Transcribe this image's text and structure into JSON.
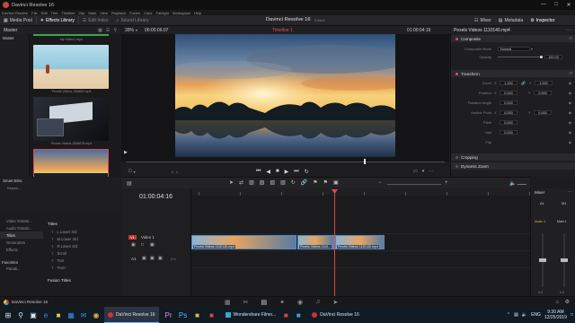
{
  "window": {
    "title": "Davinci Resolve 16",
    "min_icon": "minimize-icon",
    "max_icon": "maximize-icon",
    "close_icon": "close-icon"
  },
  "menu": [
    "DaVinci Resolve",
    "File",
    "Edit",
    "Trim",
    "Timeline",
    "Clip",
    "Mark",
    "View",
    "Playback",
    "Fusion",
    "Color",
    "Fairlight",
    "Workspace",
    "Help"
  ],
  "toolbar": {
    "media_pool": "Media Pool",
    "effects_library": "Effects Library",
    "edit_index": "Edit Index",
    "sound_library": "Sound Library",
    "project_name": "Davinci Resolve 16",
    "project_status": "Edited",
    "mixer": "Mixer",
    "metadata": "Metadata",
    "inspector": "Inspector"
  },
  "media_pool": {
    "bin_title": "Master",
    "zoom": "39%",
    "smart_bins": "Smart Bins",
    "keywords": "Keywo...",
    "clips": [
      {
        "caption": "My Video1.mp4"
      },
      {
        "caption": "Pexels Videos 180882.mp4"
      },
      {
        "caption": "Pexels Videos 1536675.mp4"
      },
      {
        "caption": "Timeline 1"
      }
    ]
  },
  "viewer": {
    "zoom": "39%",
    "source_tc": "00:00:06:07",
    "timeline_name": "Timeline 1",
    "timecode": "01:00:04:16"
  },
  "inspector": {
    "clip_title": "Pexels Videos 1110140.mp4",
    "composite": {
      "title": "Composite",
      "mode_label": "Composite Mode",
      "mode_value": "Normal",
      "opacity_label": "Opacity",
      "opacity_value": "100.00"
    },
    "transform": {
      "title": "Transform",
      "rows": [
        {
          "label": "Zoom",
          "x_label": "X",
          "x": "1.000",
          "y_label": "Y",
          "y": "1.000"
        },
        {
          "label": "Position",
          "x_label": "X",
          "x": "0.000",
          "y_label": "Y",
          "y": "0.000"
        },
        {
          "label": "Rotation Angle",
          "x_label": "",
          "x": "0.000",
          "y_label": "",
          "y": ""
        },
        {
          "label": "Anchor Point",
          "x_label": "X",
          "x": "0.000",
          "y_label": "Y",
          "y": "0.000"
        },
        {
          "label": "Pitch",
          "x_label": "",
          "x": "0.000",
          "y_label": "",
          "y": ""
        },
        {
          "label": "Yaw",
          "x_label": "",
          "x": "0.000",
          "y_label": "",
          "y": ""
        },
        {
          "label": "Flip",
          "x_label": "",
          "x": "",
          "y_label": "",
          "y": ""
        }
      ]
    },
    "cropping": "Cropping",
    "dynamic_zoom": "Dynamic Zoom"
  },
  "timeline": {
    "timecode": "01:00:04:16",
    "v1": "Video 1",
    "v1_tag": "V1",
    "a1": "A1",
    "a1_value": "2.0",
    "clips": [
      {
        "label": "Pexels Videos 1110140.mp4"
      },
      {
        "label": "Pexels Videos 1110..."
      },
      {
        "label": "Pexels Videos 1110140.mp4"
      }
    ]
  },
  "effects": {
    "items": [
      "Video Transiti...",
      "Audio Transiti...",
      "Titles",
      "Generators",
      "Effects"
    ],
    "favorites": "Favorites",
    "favorite_item": "Paradi...",
    "titles_header": "Titles",
    "titles_list": [
      "L Lower 3rd",
      "M Lower 3rd",
      "R Lower 3rd",
      "Scroll",
      "Text",
      "Text+"
    ],
    "fusion_titles": "Fusion Titles"
  },
  "mixer": {
    "title": "Mixer",
    "a1": "A1",
    "m1": "M1",
    "audio1": "Audio 1",
    "main1": "Main 1",
    "level_a1": "0.0",
    "level_m1": "0.0"
  },
  "statusbar": {
    "app": "DaVinci Resolve 16"
  },
  "taskbar": {
    "search_icon": "search-icon",
    "apps": [
      "DaVinci Resolve 16",
      "Wondershare Filmo...",
      "DaVinci Resolve 16"
    ],
    "lang": "ENG",
    "time": "9:30 AM",
    "date": "12/25/2019"
  }
}
